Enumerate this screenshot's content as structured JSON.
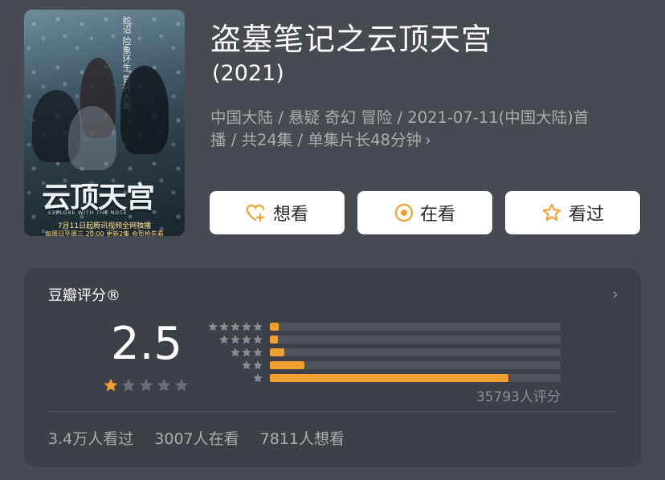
{
  "movie": {
    "title": "盗墓笔记之云顶天宫",
    "year": "(2021)",
    "meta_line1": "中国大陆 / 悬疑 奇幻 冒险 / 2021-07-11(中国大陆)首",
    "meta_line2": "播 / 共24集 / 单集片长48分钟",
    "poster": {
      "vertical_text": "蛇沼 险象环生 冒死入局",
      "title": "云顶天宫",
      "subtitle": "EXPLORE WITH THE NOTE",
      "date": "7月11日起腾讯视频全网独播",
      "date2": "每周日至周三 20:00 更新2集 会员抢先看"
    }
  },
  "actions": {
    "want": "想看",
    "watching": "在看",
    "watched": "看过"
  },
  "rating": {
    "title": "豆瓣评分®",
    "score": "2.5",
    "score_stars_filled": 1,
    "votes": "35793人评分",
    "distribution": [
      0.03,
      0.02,
      0.05,
      0.12,
      0.82
    ],
    "colors": {
      "accent": "#f0a030",
      "track": "#505359",
      "star_empty": "#6a6d73"
    }
  },
  "stats": {
    "watched": "3.4万人看过",
    "watching": "3007人在看",
    "want": "7811人想看"
  }
}
